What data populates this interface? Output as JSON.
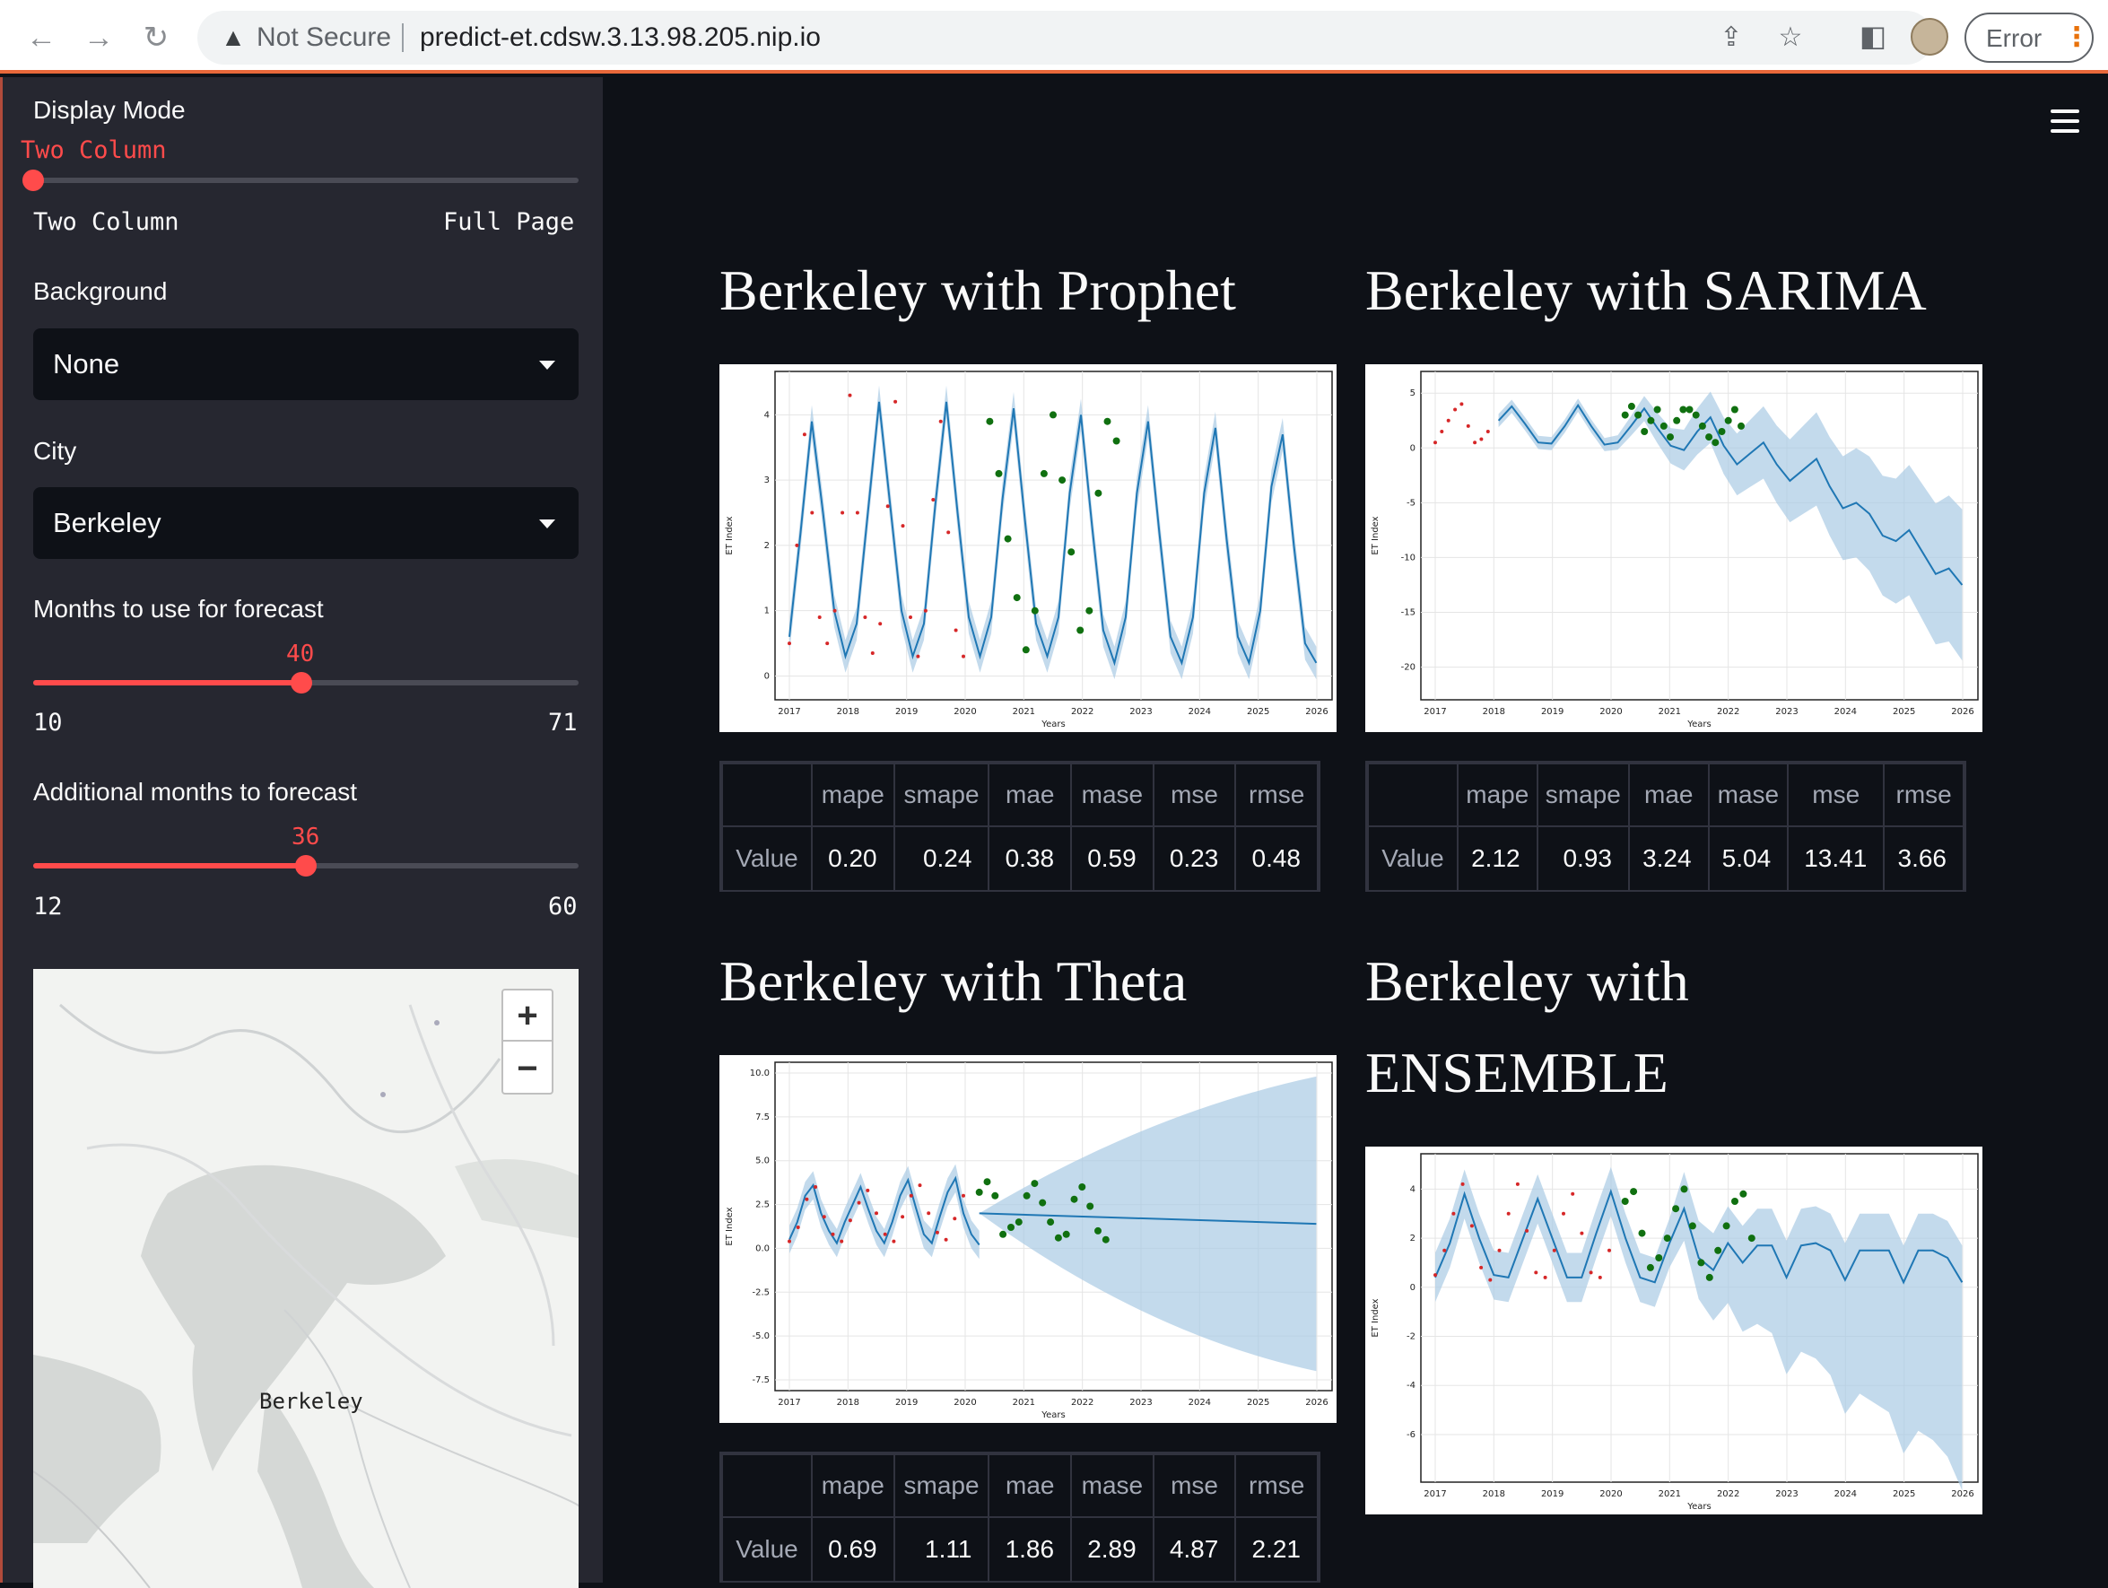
{
  "browser": {
    "security_label": "Not Secure",
    "url": "predict-et.cdsw.3.13.98.205.nip.io",
    "error_label": "Error"
  },
  "sidebar": {
    "display_mode": {
      "label": "Display Mode",
      "value": "Two Column",
      "min_label": "Two Column",
      "max_label": "Full Page"
    },
    "background": {
      "label": "Background",
      "value": "None"
    },
    "city": {
      "label": "City",
      "value": "Berkeley"
    },
    "months_forecast": {
      "label": "Months to use for forecast",
      "value": 40,
      "min": 10,
      "max": 71
    },
    "additional_months": {
      "label": "Additional months to forecast",
      "value": 36,
      "min": 12,
      "max": 60
    },
    "map": {
      "place_label": "Berkeley",
      "zoom_in": "+",
      "zoom_out": "−"
    }
  },
  "metrics_headers": [
    "",
    "mape",
    "smape",
    "mae",
    "mase",
    "mse",
    "rmse"
  ],
  "panels": [
    {
      "title": "Berkeley with Prophet",
      "metrics": {
        "row_label": "Value",
        "values": [
          "0.20",
          "0.24",
          "0.38",
          "0.59",
          "0.23",
          "0.48"
        ]
      }
    },
    {
      "title": "Berkeley with SARIMA",
      "metrics": {
        "row_label": "Value",
        "values": [
          "2.12",
          "0.93",
          "3.24",
          "5.04",
          "13.41",
          "3.66"
        ]
      }
    },
    {
      "title": "Berkeley with Theta",
      "metrics": {
        "row_label": "Value",
        "values": [
          "0.69",
          "1.11",
          "1.86",
          "2.89",
          "4.87",
          "2.21"
        ]
      }
    },
    {
      "title_line1": "Berkeley with",
      "title_line2": "ENSEMBLE"
    }
  ],
  "chart_data": [
    {
      "type": "line",
      "title": "",
      "xlabel": "Years",
      "ylabel": "ET Index",
      "x_ticks": [
        "2017",
        "2018",
        "2019",
        "2020",
        "2021",
        "2022",
        "2023",
        "2024",
        "2025",
        "2026"
      ],
      "y_ticks": [
        "0",
        "1",
        "2",
        "3",
        "4"
      ],
      "ylim": [
        -0.2,
        4.5
      ],
      "forecast": [
        0.6,
        2.2,
        3.9,
        2.5,
        1.0,
        0.3,
        0.8,
        2.5,
        4.2,
        2.6,
        1.0,
        0.3,
        0.8,
        2.6,
        4.2,
        2.5,
        0.9,
        0.3,
        0.9,
        2.7,
        4.1,
        2.4,
        0.8,
        0.3,
        0.9,
        2.8,
        4.0,
        2.3,
        0.7,
        0.2,
        0.9,
        2.8,
        3.9,
        2.2,
        0.6,
        0.2,
        0.9,
        2.8,
        3.8,
        2.1,
        0.6,
        0.2,
        1.0,
        2.9,
        3.7,
        2.0,
        0.5,
        0.2
      ],
      "band_width": 0.25,
      "train": [
        0.5,
        2.0,
        3.7,
        2.5,
        0.9,
        0.5,
        1.0,
        2.5,
        4.3,
        2.5,
        0.9,
        0.35,
        0.8,
        2.6,
        4.2,
        2.3,
        0.9,
        0.3,
        1.0,
        2.7,
        3.9,
        2.2,
        0.7,
        0.3
      ],
      "test": [
        3.9,
        3.1,
        2.1,
        1.2,
        0.4,
        1.0,
        3.1,
        4.0,
        3.0,
        1.9,
        0.7,
        1.0,
        2.8,
        3.9,
        3.6
      ]
    },
    {
      "type": "line",
      "title": "",
      "xlabel": "Years",
      "ylabel": "ET Index",
      "x_ticks": [
        "2017",
        "2018",
        "2019",
        "2020",
        "2021",
        "2022",
        "2023",
        "2024",
        "2025",
        "2026"
      ],
      "y_ticks": [
        "5",
        "0",
        "-5",
        "-10",
        "-15",
        "-20"
      ],
      "ylim": [
        -22,
        6
      ],
      "forecast": [
        2.5,
        3.8,
        2.2,
        0.5,
        0.4,
        2.0,
        3.9,
        2.0,
        0.3,
        0.5,
        2.0,
        3.6,
        1.8,
        0.2,
        -0.2,
        1.5,
        2.8,
        0.2,
        -1.5,
        -0.5,
        0.5,
        -1.5,
        -3.0,
        -2.0,
        -1.0,
        -3.5,
        -5.5,
        -5.0,
        -6.0,
        -8.0,
        -8.5,
        -7.5,
        -9.5,
        -11.5,
        -11.0,
        -12.5
      ],
      "band_width": 3.0,
      "train": [
        0.5,
        1.5,
        2.5,
        3.5,
        4.0,
        2.0,
        0.5,
        0.8,
        1.5
      ],
      "test": [
        3.0,
        3.8,
        3.0,
        1.5,
        2.5,
        3.5,
        2.0,
        1.0,
        2.5,
        3.5,
        3.5,
        3.0,
        2.0,
        1.0,
        0.5,
        1.5,
        2.5,
        3.5,
        2.0
      ]
    },
    {
      "type": "line",
      "title": "",
      "xlabel": "Years",
      "ylabel": "ET Index",
      "x_ticks": [
        "2017",
        "2018",
        "2019",
        "2020",
        "2021",
        "2022",
        "2023",
        "2024",
        "2025",
        "2026"
      ],
      "y_ticks": [
        "10.0",
        "7.5",
        "5.0",
        "2.5",
        "0.0",
        "-2.5",
        "-5.0",
        "-7.5"
      ],
      "ylim": [
        -7.5,
        10.0
      ],
      "history": [
        0.5,
        1.5,
        3.0,
        3.6,
        2.0,
        1.0,
        0.3,
        1.5,
        2.5,
        3.5,
        2.2,
        1.0,
        0.3,
        1.5,
        3.0,
        3.9,
        2.3,
        0.8,
        0.3,
        1.8,
        3.2,
        4.0,
        2.0,
        0.8,
        0.2
      ],
      "forecast_start": 2.0,
      "forecast_end": 1.4,
      "band_upper_end": 9.8,
      "band_lower_end": -7.0,
      "train": [
        0.4,
        1.2,
        2.8,
        3.5,
        1.8,
        0.8,
        0.4,
        1.6,
        2.6,
        3.3,
        2.0,
        0.8,
        0.4,
        1.8,
        3.0,
        3.6,
        2.0,
        0.9,
        0.5,
        1.7,
        3.0
      ],
      "test": [
        3.2,
        3.8,
        3.0,
        0.8,
        1.2,
        1.5,
        3.0,
        3.7,
        2.6,
        1.5,
        0.6,
        0.8,
        2.8,
        3.5,
        2.4,
        1.0,
        0.5
      ]
    },
    {
      "type": "line",
      "title": "",
      "xlabel": "Years",
      "ylabel": "ET Index",
      "x_ticks": [
        "2017",
        "2018",
        "2019",
        "2020",
        "2021",
        "2022",
        "2023",
        "2024",
        "2025",
        "2026"
      ],
      "y_ticks": [
        "4",
        "2",
        "0",
        "-2",
        "-4",
        "-6"
      ],
      "ylim": [
        -7.5,
        5.0
      ],
      "forecast": [
        0.4,
        1.8,
        3.8,
        2.0,
        0.5,
        0.4,
        2.0,
        3.6,
        2.0,
        0.4,
        0.4,
        2.2,
        3.9,
        2.0,
        0.4,
        0.2,
        1.8,
        3.2,
        1.2,
        0.7,
        1.8,
        1.0,
        1.7,
        1.7,
        0.4,
        1.7,
        1.8,
        1.5,
        0.3,
        1.5,
        1.5,
        1.5,
        0.2,
        1.5,
        1.5,
        1.2,
        0.2
      ],
      "band_width": 1.0,
      "band_lower_end": -6.8,
      "train": [
        0.5,
        1.5,
        3.0,
        4.2,
        2.5,
        0.8,
        0.3,
        1.5,
        3.0,
        4.2,
        2.3,
        0.6,
        0.4,
        1.5,
        3.0,
        3.8,
        2.2,
        0.6,
        0.4,
        1.5
      ],
      "test": [
        3.5,
        3.9,
        2.2,
        0.8,
        1.2,
        2.0,
        3.2,
        4.0,
        2.5,
        1.0,
        0.4,
        1.5,
        2.5,
        3.5,
        3.8,
        2.0
      ]
    }
  ]
}
